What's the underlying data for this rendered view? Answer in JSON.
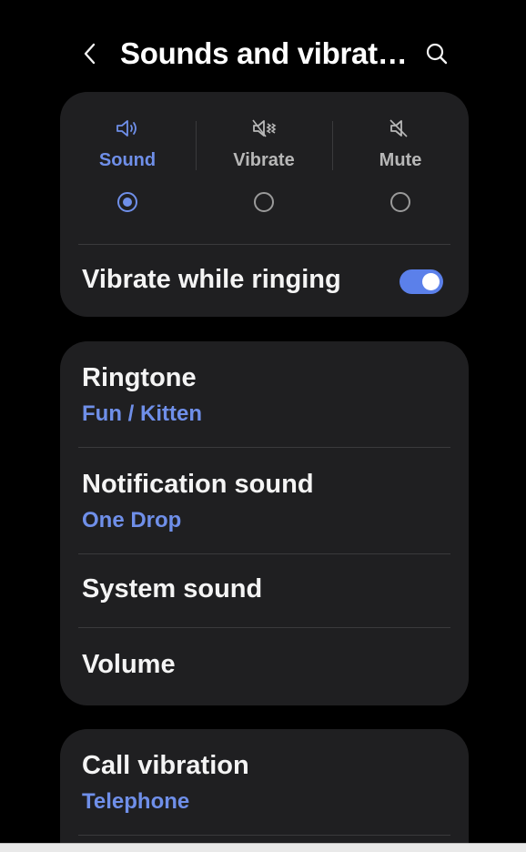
{
  "header": {
    "title": "Sounds and vibrat…",
    "back_icon": "chevron-left-icon",
    "search_icon": "search-icon"
  },
  "sound_mode": {
    "options": [
      {
        "label": "Sound",
        "icon": "speaker-icon",
        "selected": true
      },
      {
        "label": "Vibrate",
        "icon": "vibrate-icon",
        "selected": false
      },
      {
        "label": "Mute",
        "icon": "mute-icon",
        "selected": false
      }
    ],
    "vibrate_while_ringing": {
      "label": "Vibrate while ringing",
      "enabled": true
    }
  },
  "sounds": {
    "ringtone": {
      "label": "Ringtone",
      "value": "Fun / Kitten"
    },
    "notification": {
      "label": "Notification sound",
      "value": "One Drop"
    },
    "system": {
      "label": "System sound"
    },
    "volume": {
      "label": "Volume"
    }
  },
  "vibration": {
    "call": {
      "label": "Call vibration",
      "value": "Telephone"
    }
  },
  "colors": {
    "accent": "#6f8fe9",
    "toggle_on": "#5b80ea",
    "card_bg": "#1f1f21",
    "background": "#000000"
  }
}
